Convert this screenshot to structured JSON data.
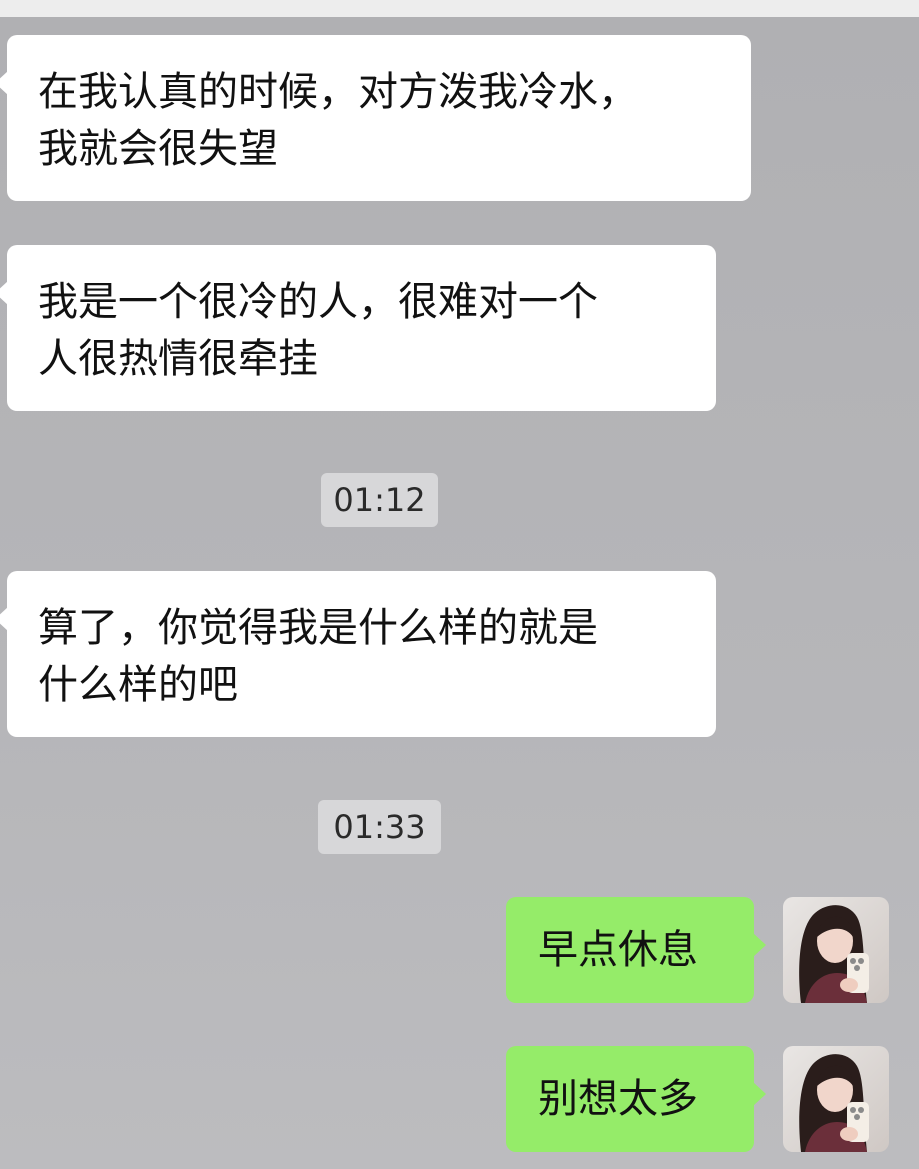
{
  "chat": {
    "messages": [
      {
        "side": "left",
        "text_line1": "在我认真的时候，对方泼我冷水，",
        "text_line2": "我就会很失望"
      },
      {
        "side": "left",
        "text_line1": "我是一个很冷的人，很难对一个",
        "text_line2": "人很热情很牵挂"
      },
      {
        "timestamp": "01:12"
      },
      {
        "side": "left",
        "text_line1": "算了，你觉得我是什么样的就是",
        "text_line2": "什么样的吧"
      },
      {
        "timestamp": "01:33"
      },
      {
        "side": "right",
        "text": "早点休息",
        "avatar": "user-avatar-photo"
      },
      {
        "side": "right",
        "text": "别想太多",
        "avatar": "user-avatar-photo"
      }
    ]
  },
  "colors": {
    "background": "#b5b5b8",
    "incoming_bubble": "#ffffff",
    "outgoing_bubble": "#95ec69",
    "timestamp_bg": "#d7d7d9"
  }
}
